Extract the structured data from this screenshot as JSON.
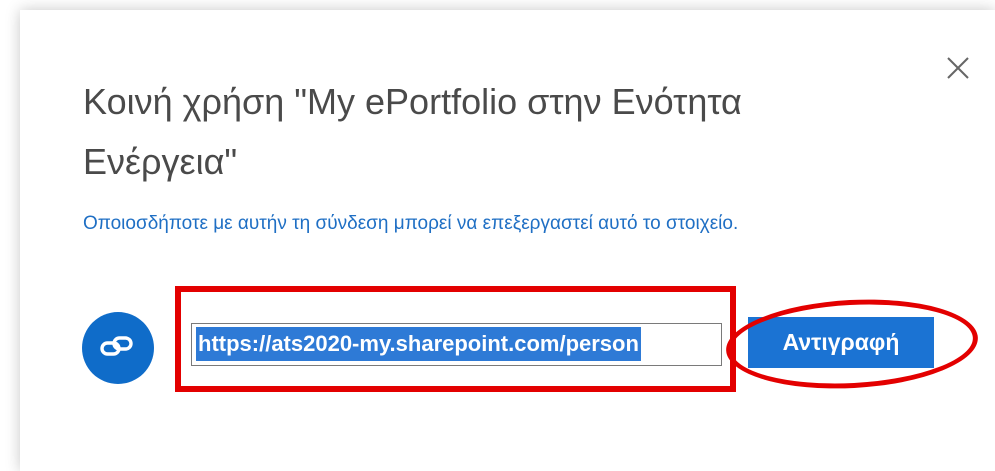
{
  "dialog": {
    "title": "Κοινή χρήση \"My ePortfolio στην Ενότητα Ενέργεια\"",
    "description": "Οποιοσδήποτε με αυτήν τη σύνδεση μπορεί να επεξεργαστεί αυτό το στοιχείο.",
    "link_url": "https://ats2020-my.sharepoint.com/person",
    "copy_button_label": "Αντιγραφή",
    "close_icon": "close-icon",
    "link_icon": "link-icon"
  },
  "colors": {
    "accent": "#1b73d3",
    "link_text": "#1f6fc4",
    "highlight_annotation": "#e30000",
    "selection": "#2e7ad6"
  }
}
